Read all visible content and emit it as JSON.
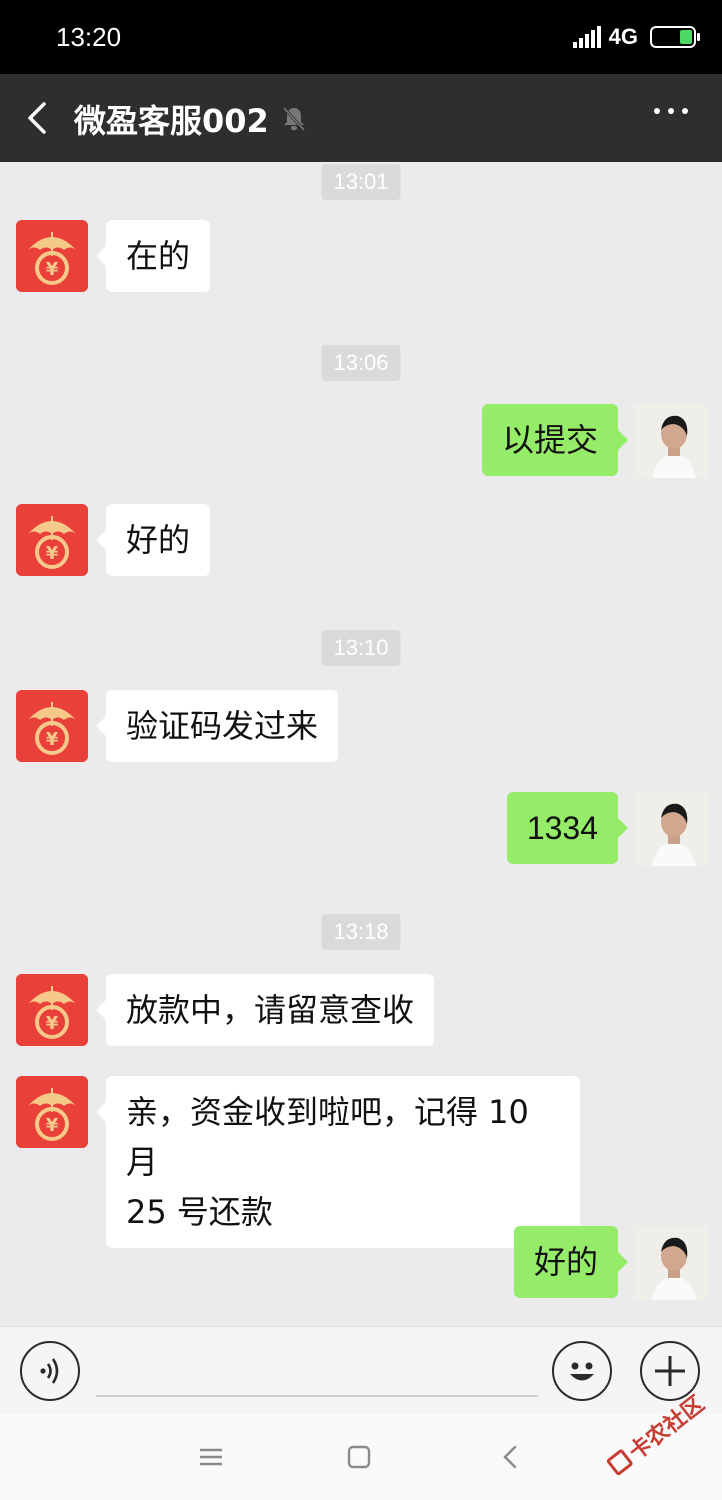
{
  "status_bar": {
    "time": "13:20",
    "network": "4G"
  },
  "header": {
    "title": "微盈客服002"
  },
  "messages": [
    {
      "type": "time",
      "text": "13:01"
    },
    {
      "type": "msg",
      "side": "left",
      "text": "在的"
    },
    {
      "type": "time",
      "text": "13:06"
    },
    {
      "type": "msg",
      "side": "right",
      "text": "以提交"
    },
    {
      "type": "msg",
      "side": "left",
      "text": "好的"
    },
    {
      "type": "time",
      "text": "13:10"
    },
    {
      "type": "msg",
      "side": "left",
      "text": "验证码发过来"
    },
    {
      "type": "msg",
      "side": "right",
      "text": "1334"
    },
    {
      "type": "time",
      "text": "13:18"
    },
    {
      "type": "msg",
      "side": "left",
      "text": "放款中，请留意查收"
    },
    {
      "type": "msg",
      "side": "left",
      "text_line1": "亲，资金收到啦吧，记得 10 月",
      "text_line2": "25 号还款"
    },
    {
      "type": "msg",
      "side": "right",
      "text": "好的"
    }
  ],
  "input": {
    "value": ""
  },
  "watermark": {
    "text": "卡农社区"
  },
  "colors": {
    "header_bg": "#2e2e2e",
    "chat_bg": "#ebebeb",
    "sent_bubble": "#95ec69",
    "received_bubble": "#ffffff",
    "avatar_bot": "#e9413a"
  },
  "icons": [
    "back-arrow-icon",
    "mute-bell-icon",
    "more-dots-icon",
    "voice-icon",
    "emoji-icon",
    "plus-icon",
    "menu-icon",
    "home-square-icon",
    "nav-back-icon"
  ]
}
